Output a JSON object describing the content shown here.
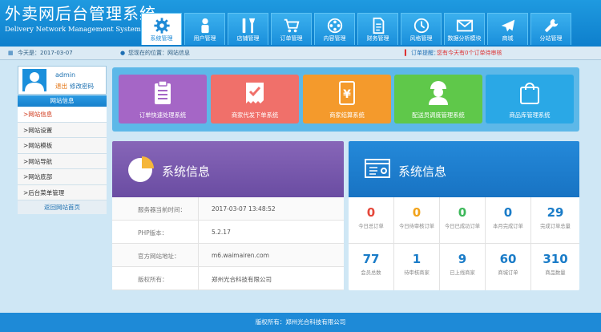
{
  "header": {
    "title": "外卖网后台管理系统",
    "subtitle": "Delivery Network Management System"
  },
  "nav": [
    {
      "label": "系统管理",
      "icon": "gear-icon",
      "active": true
    },
    {
      "label": "用户管理",
      "icon": "user-icon"
    },
    {
      "label": "店铺管理",
      "icon": "tools-icon"
    },
    {
      "label": "订单管理",
      "icon": "cart-icon"
    },
    {
      "label": "内容管理",
      "icon": "film-reel-icon"
    },
    {
      "label": "财务管理",
      "icon": "document-icon"
    },
    {
      "label": "风格管理",
      "icon": "clock-icon"
    },
    {
      "label": "数据分析模块",
      "icon": "mail-icon"
    },
    {
      "label": "商城",
      "icon": "airplane-icon"
    },
    {
      "label": "分站管理",
      "icon": "wrench-icon"
    }
  ],
  "subbar": {
    "date": "今天是：2017-03-07",
    "position": "您现在的位置：网站信息",
    "order_label": "订单提醒：",
    "order_text": "您有今天有0个订单待审核"
  },
  "user": {
    "name": "admin",
    "logout": "退出",
    "change_password": "修改密码"
  },
  "sidebar": {
    "title": "网站信息",
    "items": [
      {
        "label": ">网站信息",
        "active": true
      },
      {
        "label": ">网站设置"
      },
      {
        "label": ">网站模板"
      },
      {
        "label": ">网站导航"
      },
      {
        "label": ">网站底部"
      },
      {
        "label": ">后台菜单管理"
      }
    ],
    "back": "返回网站首页"
  },
  "tiles": [
    {
      "label": "订单快速处理系统",
      "color": "#a566c6",
      "icon": "clipboard-icon"
    },
    {
      "label": "商家代发下单系统",
      "color": "#f0706a",
      "icon": "checklist-icon"
    },
    {
      "label": "商家结算系统",
      "color": "#f49a2c",
      "icon": "yen-receipt-icon"
    },
    {
      "label": "配送员调度管理系统",
      "color": "#5fc84a",
      "icon": "courier-icon"
    },
    {
      "label": "商品库管理系统",
      "color": "#2aa8e6",
      "icon": "shopping-bag-icon"
    }
  ],
  "system_info": {
    "title": "系统信息",
    "rows": [
      {
        "key": "服务器当前时间：",
        "value": "2017-03-07 13:48:52"
      },
      {
        "key": "PHP版本：",
        "value": "5.2.17"
      },
      {
        "key": "官方网站地址：",
        "value": "m6.waimairen.com"
      },
      {
        "key": "版权所有：",
        "value": "郑州光合科技有限公司"
      }
    ]
  },
  "stats": {
    "title": "系统信息",
    "items": [
      {
        "value": "0",
        "label": "今日总订单",
        "color": "#e5483b"
      },
      {
        "value": "0",
        "label": "今日待审核订单",
        "color": "#f2a31a"
      },
      {
        "value": "0",
        "label": "今日已成功订单",
        "color": "#3db85a"
      },
      {
        "value": "0",
        "label": "本月完成订单",
        "color": "#1a7cc8"
      },
      {
        "value": "29",
        "label": "完成订单总量",
        "color": "#1a7cc8"
      },
      {
        "value": "77",
        "label": "会员总数",
        "color": "#1a7cc8"
      },
      {
        "value": "1",
        "label": "待审核商家",
        "color": "#1a7cc8"
      },
      {
        "value": "9",
        "label": "已上线商家",
        "color": "#1a7cc8"
      },
      {
        "value": "60",
        "label": "商城订单",
        "color": "#1a7cc8"
      },
      {
        "value": "310",
        "label": "商品数量",
        "color": "#1a7cc8"
      }
    ]
  },
  "footer": {
    "text": "版权所有：郑州光合科技有限公司"
  }
}
